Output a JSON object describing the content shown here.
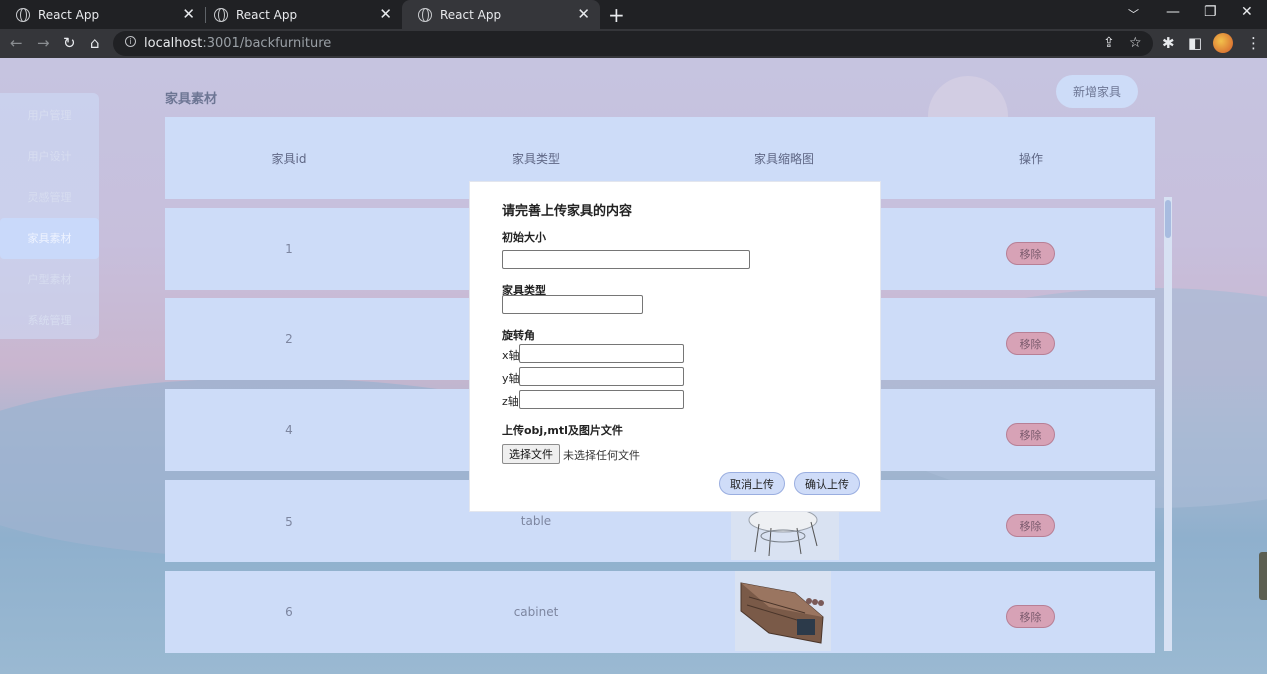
{
  "browser": {
    "tabs": [
      {
        "title": "React App",
        "active": false
      },
      {
        "title": "React App",
        "active": false
      },
      {
        "title": "React App",
        "active": true
      }
    ],
    "url_host": "localhost",
    "url_path": ":3001/backfurniture"
  },
  "sidebar": {
    "items": [
      {
        "label": "用户管理"
      },
      {
        "label": "用户设计"
      },
      {
        "label": "灵感管理"
      },
      {
        "label": "家具素材"
      },
      {
        "label": "户型素材"
      },
      {
        "label": "系统管理"
      }
    ],
    "active_index": 3
  },
  "page": {
    "title": "家具素材",
    "add_button": "新增家具"
  },
  "table": {
    "columns": [
      "家具id",
      "家具类型",
      "家具缩略图",
      "操作"
    ],
    "rows": [
      {
        "id": "1",
        "type": "",
        "action": "移除"
      },
      {
        "id": "2",
        "type": "",
        "action": "移除"
      },
      {
        "id": "4",
        "type": "",
        "action": "移除"
      },
      {
        "id": "5",
        "type": "table",
        "action": "移除"
      },
      {
        "id": "6",
        "type": "cabinet",
        "action": "移除"
      }
    ]
  },
  "modal": {
    "title": "请完善上传家具的内容",
    "initial_size_label": "初始大小",
    "type_label": "家具类型",
    "rotation_label": "旋转角",
    "x_label": "x轴",
    "y_label": "y轴",
    "z_label": "z轴",
    "upload_label": "上传obj,mtl及图片文件",
    "file_button": "选择文件",
    "file_status": "未选择任何文件",
    "cancel_button": "取消上传",
    "confirm_button": "确认上传"
  },
  "colors": {
    "panel": "#cddcf8",
    "remove_button": "#d7a2b6"
  }
}
